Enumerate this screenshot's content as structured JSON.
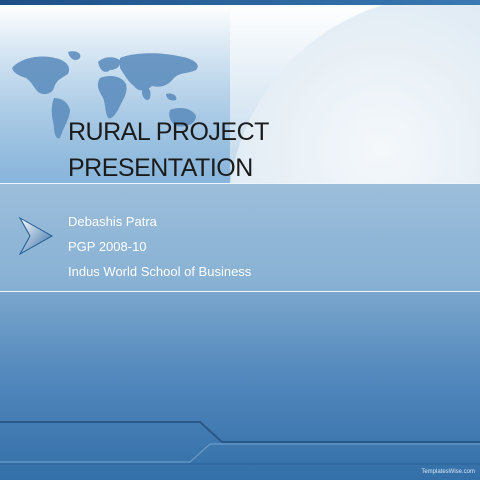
{
  "slide": {
    "title_line1": "RURAL PROJECT",
    "title_line2": "PRESENTATION",
    "subtitle": {
      "author": "Debashis Patra",
      "program": "PGP 2008-10",
      "institution": "Indus World School of Business"
    },
    "watermark": "TemplatesWise.com"
  },
  "icons": {
    "world_map": "world-map-icon",
    "bullet": "chevron-right-icon"
  },
  "colors": {
    "title_text": "#1b1b1b",
    "subtitle_text": "#ffffff",
    "accent_blue": "#336fa8"
  }
}
